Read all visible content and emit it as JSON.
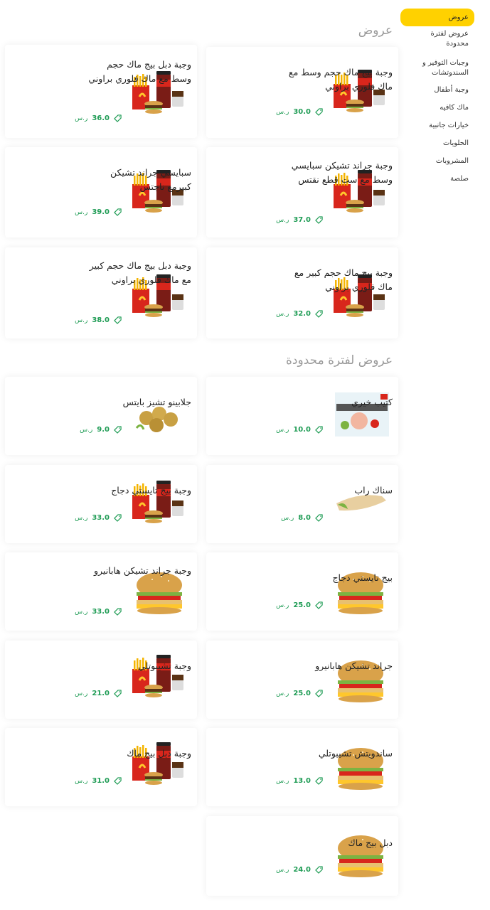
{
  "sidebar": {
    "items": [
      {
        "label": "عروض"
      },
      {
        "label": "عروض لفترة محدودة"
      },
      {
        "label": "وجبات التوفير و السندوتشات"
      },
      {
        "label": "وجبة أطفال"
      },
      {
        "label": "ماك كافيه"
      },
      {
        "label": "خيارات جانبية"
      },
      {
        "label": "الحلويات"
      },
      {
        "label": "المشروبات"
      },
      {
        "label": "صلصة"
      }
    ]
  },
  "sections": [
    {
      "title": "عروض"
    },
    {
      "title": "عروض لفترة محدودة"
    }
  ],
  "currency": "ر.س",
  "offers": [
    {
      "name": "وجبة بيج ماك حجم وسط مع ماك فلوري براوني",
      "price": "30.0",
      "image": "bigmac-meal-mcflurry"
    },
    {
      "name": "وجبة دبل بيج ماك حجم وسط مع ماك فلوري براوني",
      "price": "36.0",
      "image": "double-bigmac-meal-mcflurry"
    },
    {
      "name": "وجبة جراند تشيكن سبايسي وسط مع ست قطع نقتس",
      "price": "37.0",
      "image": "grand-chicken-nuggets-meal"
    },
    {
      "name": "سبايسي جراند تشيكن كبيرمع ناجتس",
      "price": "39.0",
      "image": "spicy-grand-chicken-nuggets-meal"
    },
    {
      "name": "وجبة بيج ماك حجم كبير مع ماك فلوري براوني",
      "price": "32.0",
      "image": "bigmac-large-meal-mcflurry"
    },
    {
      "name": "وجبة دبل بيج ماك حجم كبير مع ماك فلوري براوني",
      "price": "38.0",
      "image": "double-bigmac-large-meal-mcflurry"
    }
  ],
  "limited": [
    {
      "name": "كتيب خيري",
      "price": "10.0",
      "image": "charity-booklet"
    },
    {
      "name": "جلابينو تشيز بايتس",
      "price": "9.0",
      "image": "jalapeno-cheese-bites"
    },
    {
      "name": "سناك راب",
      "price": "8.0",
      "image": "snack-wrap"
    },
    {
      "name": "وجبة بيج تايستي دجاج",
      "price": "33.0",
      "image": "big-tasty-chicken-meal"
    },
    {
      "name": "بيج تايستي دجاج",
      "price": "25.0",
      "image": "big-tasty-chicken"
    },
    {
      "name": "وجبة جراند تشيكن هابانيرو",
      "price": "33.0",
      "image": "grand-chicken-habanero-meal"
    },
    {
      "name": "جراند تشيكن هابانيرو",
      "price": "25.0",
      "image": "grand-chicken-habanero"
    },
    {
      "name": "وجبة تشيبوتلي",
      "price": "21.0",
      "image": "chipotle-meal"
    },
    {
      "name": "ساندويتش تشيبوتلي",
      "price": "13.0",
      "image": "chipotle-sandwich"
    },
    {
      "name": "وجبة دبل بيج ماك",
      "price": "31.0",
      "image": "double-bigmac-meal"
    },
    {
      "name": "دبل بيج ماك",
      "price": "24.0",
      "image": "double-bigmac"
    }
  ],
  "colors": {
    "accent": "#ffd100",
    "price": "#1f9c55"
  }
}
